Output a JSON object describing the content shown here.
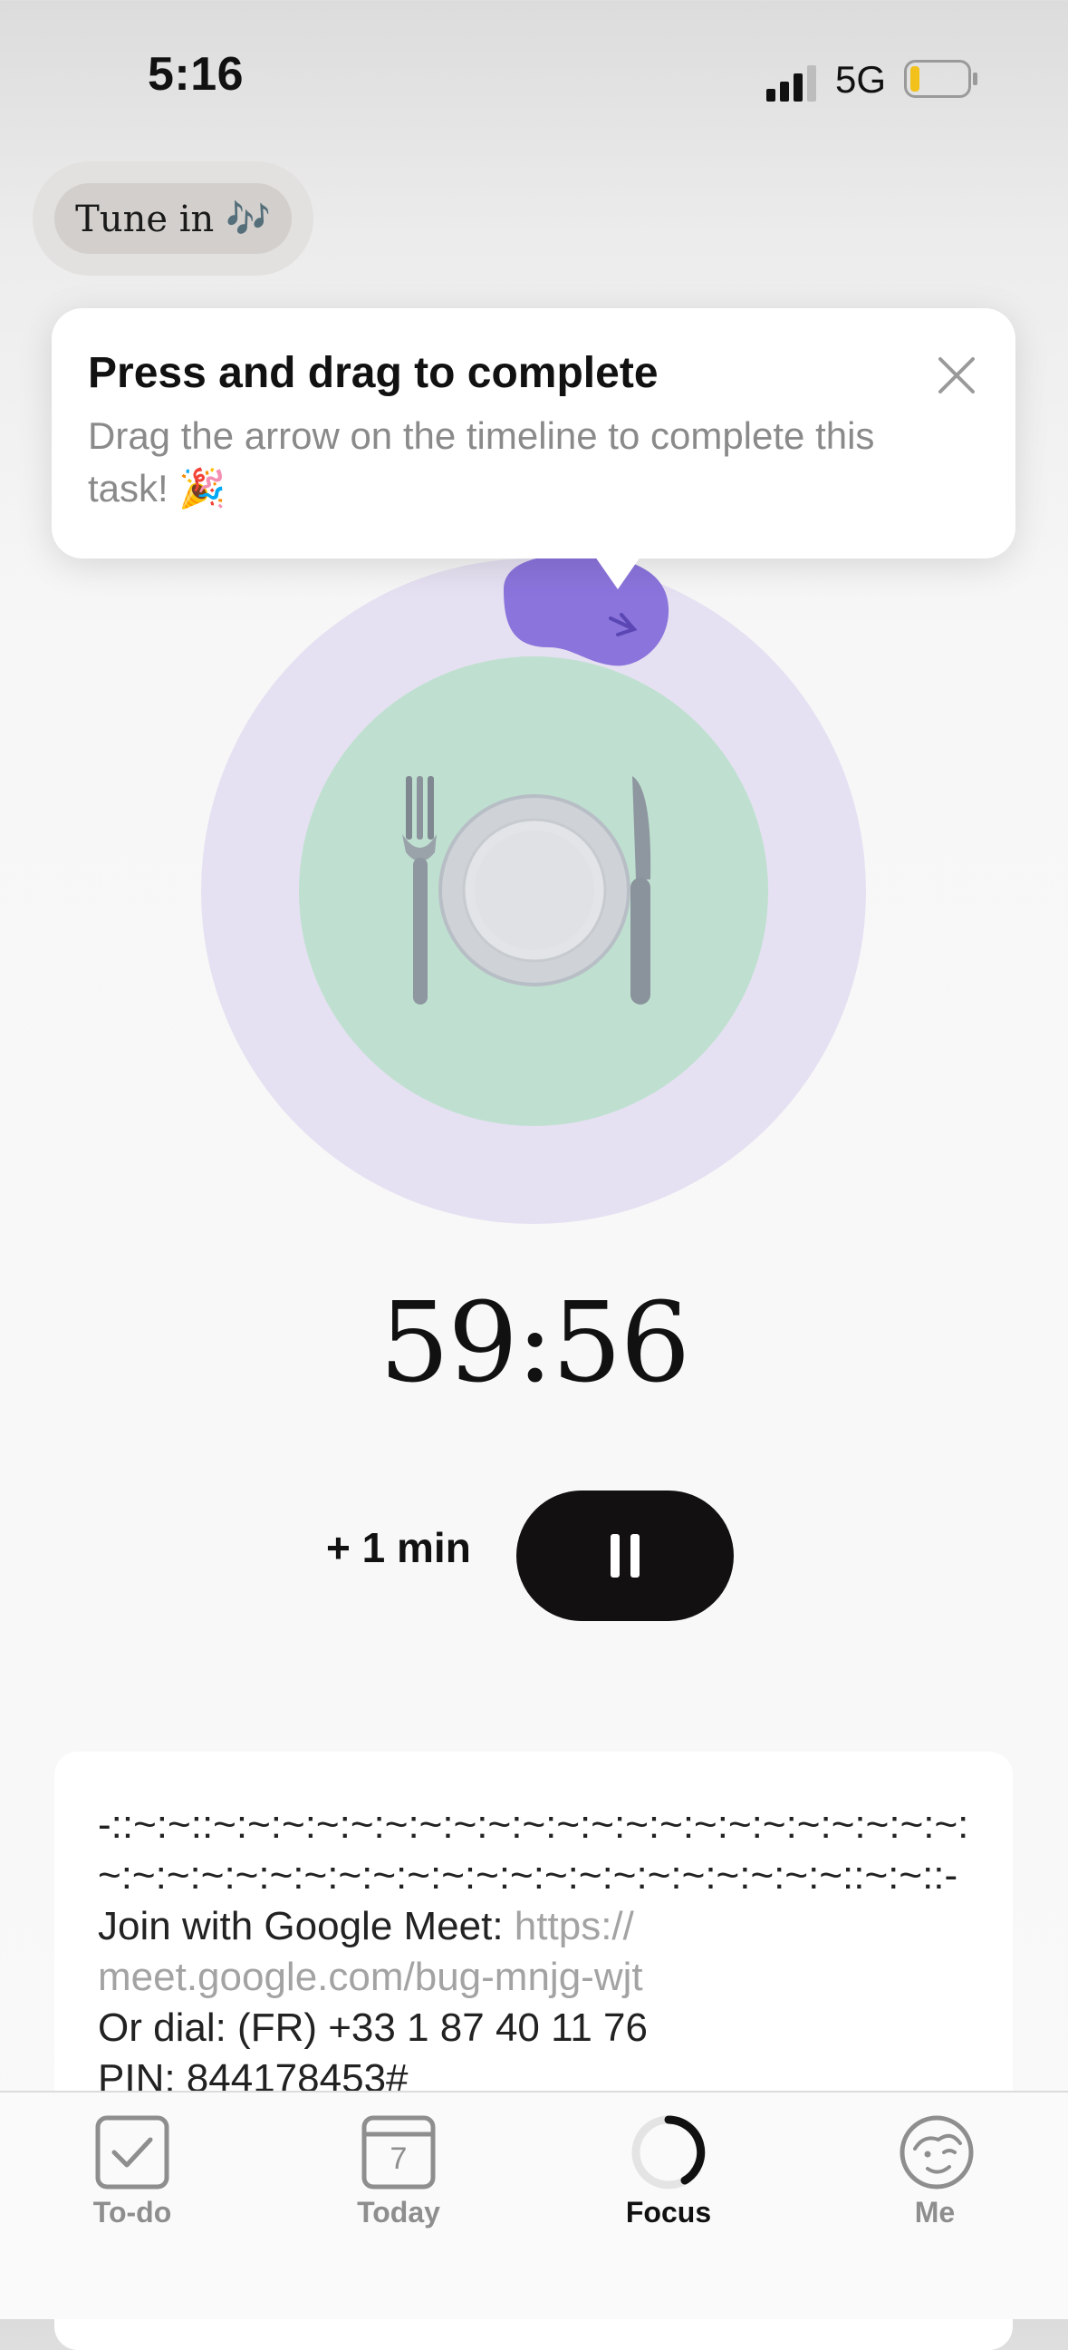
{
  "status_bar": {
    "time": "5:16",
    "network": "5G"
  },
  "tune_in": {
    "label": "Tune in 🎶"
  },
  "popover": {
    "title": "Press and drag to complete",
    "body": "Drag the arrow on the timeline to complete this task! 🎉"
  },
  "timer": {
    "display": "59:56"
  },
  "controls": {
    "add_minute_label": "+ 1 min"
  },
  "notes": {
    "line1": "-::~:~::~:~:~:~:~:~:~:~:~:~:~:~:~:~:~:~:~:~:~:~:~:~:",
    "line2": "~:~:~:~:~:~:~:~:~:~:~:~:~:~:~:~:~:~:~:~:~:~::~:~::-",
    "meet_label": "Join with Google Meet: ",
    "meet_link_1": "https://",
    "meet_link_2": "meet.google.com/bug-mnjg-wjt",
    "dial": "Or dial: (FR) +33 1 87 40 11 76",
    "pin": "PIN: 844178453#"
  },
  "tabbar": {
    "tabs": [
      {
        "label": "To-do",
        "icon": "checkbox-icon"
      },
      {
        "label": "Today",
        "icon": "calendar-icon",
        "date": "7"
      },
      {
        "label": "Focus",
        "icon": "focus-progress-icon",
        "active": true
      },
      {
        "label": "Me",
        "icon": "face-icon"
      }
    ]
  },
  "colors": {
    "outer_circle": "#e6e1f2",
    "inner_circle": "#bfe0d0",
    "handle": "#8b74dc",
    "pause_button": "#121010"
  }
}
